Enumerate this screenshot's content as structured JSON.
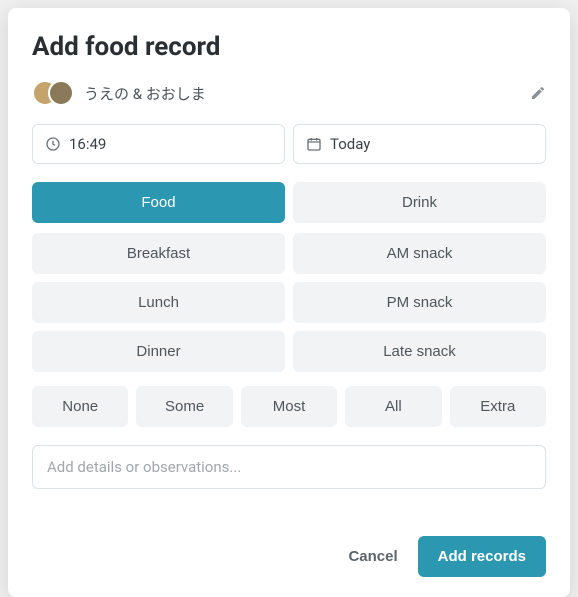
{
  "title": "Add food record",
  "user": {
    "name": "うえの & おおしま"
  },
  "time": {
    "value": "16:49"
  },
  "date": {
    "value": "Today"
  },
  "type_tabs": {
    "food": "Food",
    "drink": "Drink",
    "selected": "food"
  },
  "meals": {
    "breakfast": "Breakfast",
    "am_snack": "AM snack",
    "lunch": "Lunch",
    "pm_snack": "PM snack",
    "dinner": "Dinner",
    "late_snack": "Late snack"
  },
  "amounts": {
    "none": "None",
    "some": "Some",
    "most": "Most",
    "all": "All",
    "extra": "Extra"
  },
  "details": {
    "placeholder": "Add details or observations...",
    "value": ""
  },
  "footer": {
    "cancel": "Cancel",
    "submit": "Add records"
  }
}
